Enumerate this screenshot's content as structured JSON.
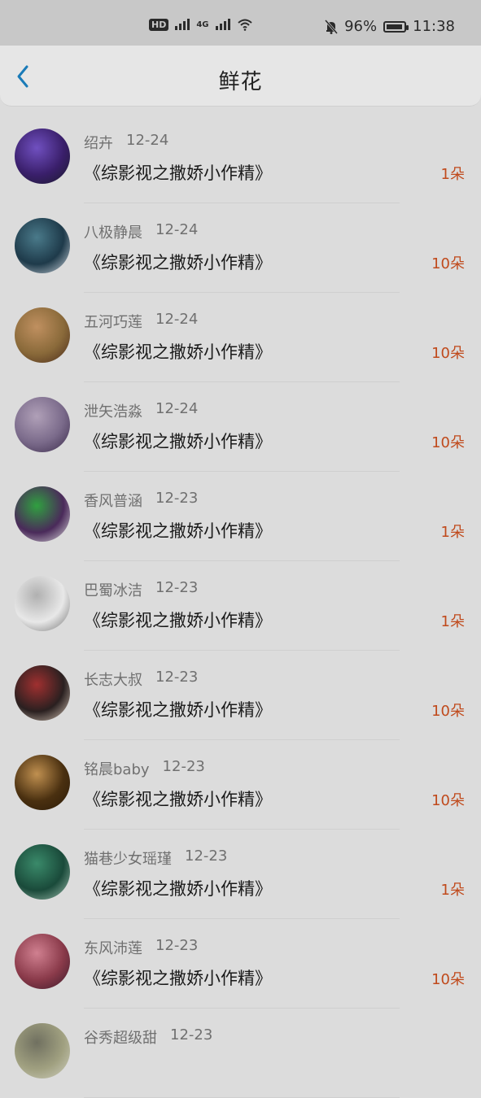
{
  "status_bar": {
    "hd_label": "HD",
    "net_label": "4G",
    "battery_percent": "96%",
    "battery_level": 0.96,
    "time": "11:38"
  },
  "header": {
    "title": "鲜花",
    "back_icon": "chevron-left-icon"
  },
  "list": [
    {
      "name": "绍卉",
      "date": "12-24",
      "book": "《综影视之撒娇小作精》",
      "count": "1朵",
      "avatar_colors": [
        "#3a1f6b",
        "#7050c0",
        "#1a1a2a"
      ]
    },
    {
      "name": "八极静晨",
      "date": "12-24",
      "book": "《综影视之撒娇小作精》",
      "count": "10朵",
      "avatar_colors": [
        "#1e3a4a",
        "#4a7a8a",
        "#d0d8e0"
      ]
    },
    {
      "name": "五河巧莲",
      "date": "12-24",
      "book": "《综影视之撒娇小作精》",
      "count": "10朵",
      "avatar_colors": [
        "#8a6a3a",
        "#c09060",
        "#4a2a1a"
      ]
    },
    {
      "name": "泄矢浩淼",
      "date": "12-24",
      "book": "《综影视之撒娇小作精》",
      "count": "10朵",
      "avatar_colors": [
        "#7a6a8a",
        "#b0a0b8",
        "#3a2a4a"
      ]
    },
    {
      "name": "香风普涵",
      "date": "12-23",
      "book": "《综影视之撒娇小作精》",
      "count": "1朵",
      "avatar_colors": [
        "#4a2a5a",
        "#30a040",
        "#e0e0e0"
      ]
    },
    {
      "name": "巴蜀冰洁",
      "date": "12-23",
      "book": "《综影视之撒娇小作精》",
      "count": "1朵",
      "avatar_colors": [
        "#e8e8e8",
        "#b0b0b0",
        "#707070"
      ]
    },
    {
      "name": "长志大叔",
      "date": "12-23",
      "book": "《综影视之撒娇小作精》",
      "count": "10朵",
      "avatar_colors": [
        "#2a2020",
        "#a03030",
        "#d8c8b8"
      ]
    },
    {
      "name": "铭晨baby",
      "date": "12-23",
      "book": "《综影视之撒娇小作精》",
      "count": "10朵",
      "avatar_colors": [
        "#4a3010",
        "#c09050",
        "#2a1a08"
      ]
    },
    {
      "name": "猫巷少女瑶瑾",
      "date": "12-23",
      "book": "《综影视之撒娇小作精》",
      "count": "1朵",
      "avatar_colors": [
        "#1a4a3a",
        "#3a8a6a",
        "#a0c0b0"
      ]
    },
    {
      "name": "东风沛莲",
      "date": "12-23",
      "book": "《综影视之撒娇小作精》",
      "count": "10朵",
      "avatar_colors": [
        "#8a3a4a",
        "#d08090",
        "#3a1a2a"
      ]
    },
    {
      "name": "谷秀超级甜",
      "date": "12-23",
      "book": "",
      "count": "",
      "avatar_colors": [
        "#a0a080",
        "#707060",
        "#d0d0c0"
      ]
    }
  ]
}
